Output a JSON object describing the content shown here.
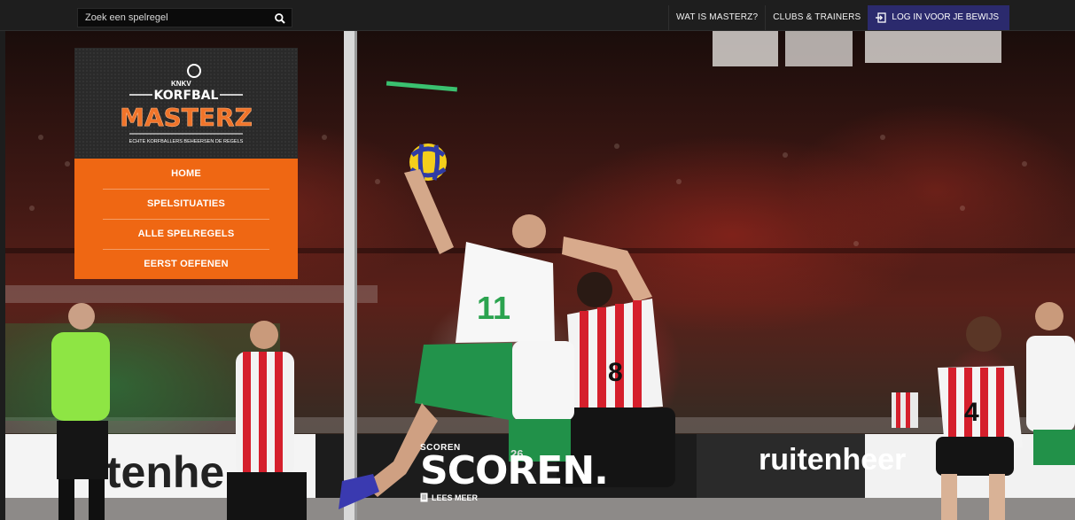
{
  "search": {
    "placeholder": "Zoek een spelregel"
  },
  "topnav": {
    "links": [
      "WAT IS MASTERZ?",
      "CLUBS & TRAINERS"
    ],
    "login_label": "LOG IN VOOR JE BEWIJS"
  },
  "logo": {
    "org": "KNKV",
    "word1": "KORFBAL",
    "word2": "MASTERZ",
    "tagline": "ECHTE KORFBALLERS BEHEERSEN DE REGELS"
  },
  "menu": {
    "items": [
      "HOME",
      "SPELSITUATIES",
      "ALLE SPELREGELS",
      "EERST OEFENEN"
    ]
  },
  "hero": {
    "kicker": "SCOREN",
    "headline": "SCOREN.",
    "read_more": "LEES MEER",
    "banner_text": "ruitenheer",
    "player_numbers": [
      "11",
      "8",
      "4",
      "26"
    ]
  },
  "colors": {
    "accent": "#ef6713",
    "login_bg": "#2b2a6d",
    "topbar": "#1e1e1e"
  }
}
